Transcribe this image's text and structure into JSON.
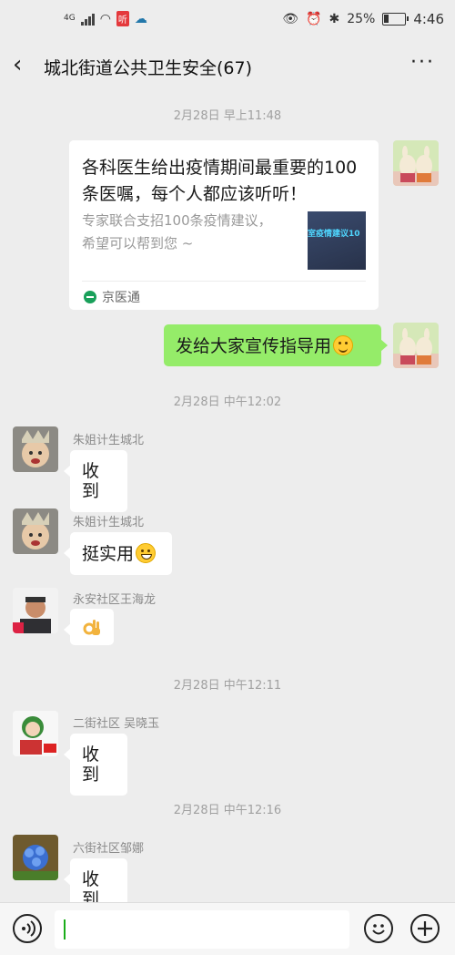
{
  "status_bar": {
    "signal_label": "4G",
    "ting_badge": "听",
    "battery": "25%",
    "battery_level": 0.25,
    "time": "4:46"
  },
  "header": {
    "title": "城北街道公共卫生安全(67)"
  },
  "messages": [
    {
      "type": "time",
      "text": "2月28日 早上11:48"
    },
    {
      "type": "link_card",
      "title": "各科医生给出疫情期间最重要的100条医嘱，每个人都应该听听！",
      "description": "专家联合支招100条疫情建议，希望可以帮到您 ~",
      "thumb_text": "室疫情建议10",
      "source": "京医通"
    },
    {
      "type": "text_out",
      "text": "发给大家宣传指导用"
    },
    {
      "type": "time",
      "text": "2月28日 中午12:02"
    },
    {
      "type": "text_in",
      "sender": "朱姐计生城北",
      "text": "收到"
    },
    {
      "type": "text_in",
      "sender": "朱姐计生城北",
      "text": "挺实用"
    },
    {
      "type": "emoji_in",
      "sender": "永安社区王海龙",
      "emoji": "ok-hand"
    },
    {
      "type": "time",
      "text": "2月28日 中午12:11"
    },
    {
      "type": "text_in",
      "sender": "二街社区 吴晓玉",
      "text": "收到"
    },
    {
      "type": "time",
      "text": "2月28日 中午12:16"
    },
    {
      "type": "text_in",
      "sender": "六街社区邹娜",
      "text": "收到"
    }
  ],
  "input_bar": {
    "voice_icon": "voice-icon",
    "emoji_icon": "smiley-icon",
    "plus_icon": "plus-icon"
  }
}
